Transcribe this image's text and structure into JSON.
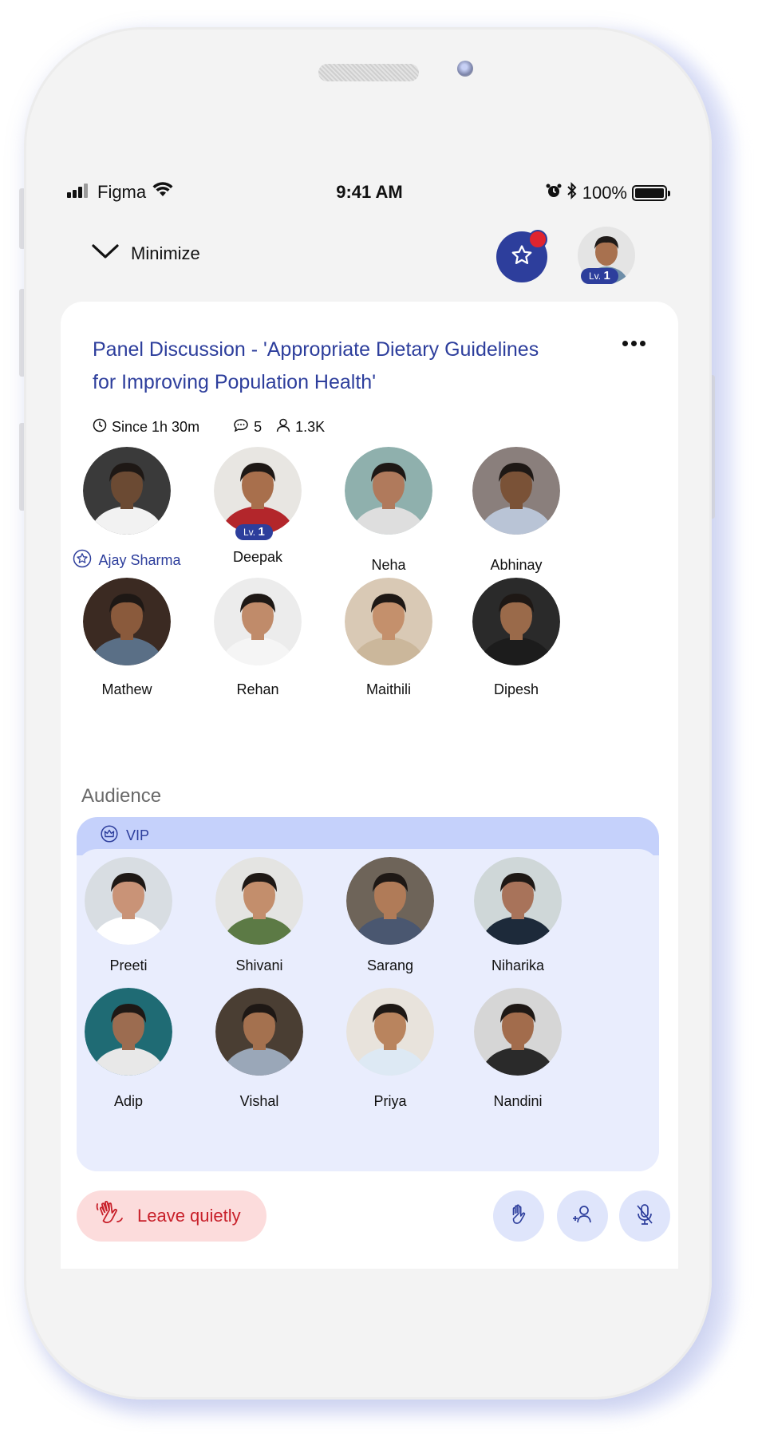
{
  "status_bar": {
    "carrier": "Figma",
    "time": "9:41 AM",
    "battery": "100%",
    "battery_level": 1.0
  },
  "topbar": {
    "minimize_label": "Minimize",
    "profile_level_prefix": "Lv.",
    "profile_level": "1"
  },
  "room": {
    "title": "Panel Discussion - 'Appropriate Dietary Guidelines for Improving Population Health'",
    "since": "Since 1h 30m",
    "comments": "5",
    "listeners": "1.3K"
  },
  "speakers": [
    {
      "name": "Ajay Sharma",
      "role": "host",
      "skin": "#6b4a33",
      "bg": "#3a3a3a",
      "shirt": "#f2f2f2"
    },
    {
      "name": "Deepak",
      "level_prefix": "Lv.",
      "level": "1",
      "skin": "#a86f4c",
      "bg": "#e8e6e2",
      "shirt": "#b3262b"
    },
    {
      "name": "Neha",
      "skin": "#b07a5c",
      "bg": "#8fb0ad",
      "shirt": "#dedede"
    },
    {
      "name": "Abhinay",
      "skin": "#7a5237",
      "bg": "#8a7f7c",
      "shirt": "#b9c4d6"
    },
    {
      "name": "Mathew",
      "skin": "#8a5a3c",
      "bg": "#3b2a22",
      "shirt": "#5a6f86"
    },
    {
      "name": "Rehan",
      "skin": "#c08b6a",
      "bg": "#ececec",
      "shirt": "#f5f5f5"
    },
    {
      "name": "Maithili",
      "skin": "#c4906c",
      "bg": "#d9c9b5",
      "shirt": "#cbb79b"
    },
    {
      "name": "Dipesh",
      "skin": "#9a6a4a",
      "bg": "#2a2a2a",
      "shirt": "#1c1c1c"
    }
  ],
  "audience": {
    "label": "Audience",
    "vip_label": "VIP",
    "members": [
      {
        "name": "Preeti",
        "skin": "#c99377",
        "bg": "#d8dde2",
        "shirt": "#ffffff"
      },
      {
        "name": "Shivani",
        "skin": "#c38e6c",
        "bg": "#e4e4e2",
        "shirt": "#5c7a45"
      },
      {
        "name": "Sarang",
        "skin": "#b07b58",
        "bg": "#6e6459",
        "shirt": "#4a5770"
      },
      {
        "name": "Niharika",
        "skin": "#a8735a",
        "bg": "#cfd7d8",
        "shirt": "#1d2a3a"
      },
      {
        "name": "Adip",
        "skin": "#9c6c50",
        "bg": "#1f6b74",
        "shirt": "#e8e8e8"
      },
      {
        "name": "Vishal",
        "skin": "#a4714f",
        "bg": "#4a3e33",
        "shirt": "#9aa7b8"
      },
      {
        "name": "Priya",
        "skin": "#b9845e",
        "bg": "#e8e3dc",
        "shirt": "#dde9f4"
      },
      {
        "name": "Nandini",
        "skin": "#a26c4c",
        "bg": "#d6d6d6",
        "shirt": "#2a2a2a"
      }
    ]
  },
  "actions": {
    "leave_label": "Leave quietly"
  },
  "colors": {
    "primary": "#2d3e9c",
    "danger": "#c8202a",
    "vip_bg": "#e9edfd",
    "vip_header": "#c5d1fb"
  }
}
